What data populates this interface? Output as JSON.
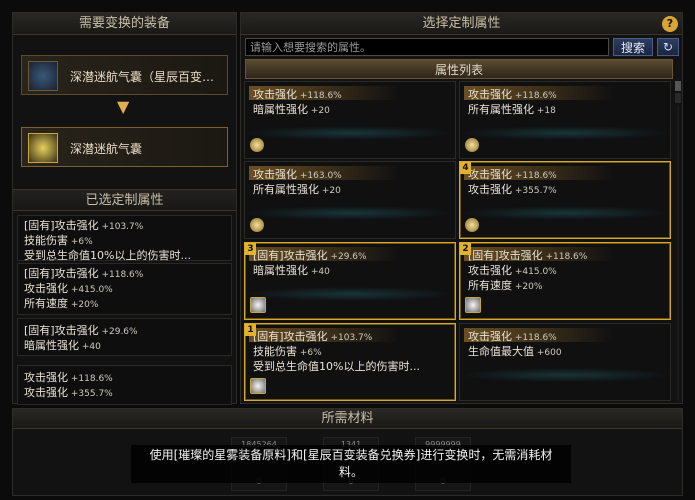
{
  "left": {
    "title": "需要变换的装备",
    "source_equip": "深潜迷航气囊（星辰百变…",
    "target_equip": "深潜迷航气囊",
    "selected_title": "已选定制属性",
    "selected": [
      {
        "lines": [
          {
            "t": "[固有]攻击强化",
            "v": "+103.7%"
          },
          {
            "t": "技能伤害",
            "v": "+6%"
          },
          {
            "t": "受到总生命值10%以上的伤害时...",
            "v": ""
          }
        ]
      },
      {
        "lines": [
          {
            "t": "[固有]攻击强化",
            "v": "+118.6%"
          },
          {
            "t": "攻击强化",
            "v": "+415.0%"
          },
          {
            "t": "所有速度",
            "v": "+20%"
          }
        ]
      },
      {
        "lines": [
          {
            "t": "[固有]攻击强化",
            "v": "+29.6%"
          },
          {
            "t": "暗属性强化",
            "v": "+40"
          }
        ]
      },
      {
        "lines": [
          {
            "t": "攻击强化",
            "v": "+118.6%"
          },
          {
            "t": "攻击强化",
            "v": "+355.7%"
          }
        ]
      }
    ]
  },
  "right": {
    "title": "选择定制属性",
    "help": "?",
    "search_placeholder": "请输入想要搜索的属性。",
    "search_button": "搜索",
    "refresh_icon": "↻",
    "list_title": "属性列表",
    "cards": [
      {
        "badge": "",
        "highlighted": false,
        "icon": "gem",
        "lines": [
          {
            "t": "攻击强化",
            "v": "+118.6%"
          },
          {
            "t": "暗属性强化",
            "v": "+20"
          }
        ]
      },
      {
        "badge": "",
        "highlighted": false,
        "icon": "gem",
        "lines": [
          {
            "t": "攻击强化",
            "v": "+118.6%"
          },
          {
            "t": "所有属性强化",
            "v": "+18"
          }
        ]
      },
      {
        "badge": "",
        "highlighted": false,
        "icon": "gem",
        "lines": [
          {
            "t": "攻击强化",
            "v": "+163.0%"
          },
          {
            "t": "所有属性强化",
            "v": "+20"
          }
        ]
      },
      {
        "badge": "4",
        "highlighted": true,
        "icon": "gem",
        "lines": [
          {
            "t": "攻击强化",
            "v": "+118.6%"
          },
          {
            "t": "攻击强化",
            "v": "+355.7%"
          }
        ]
      },
      {
        "badge": "3",
        "highlighted": true,
        "icon": "box",
        "lines": [
          {
            "t": "[固有]攻击强化",
            "v": "+29.6%"
          },
          {
            "t": "暗属性强化",
            "v": "+40"
          }
        ]
      },
      {
        "badge": "2",
        "highlighted": true,
        "icon": "box",
        "lines": [
          {
            "t": "[固有]攻击强化",
            "v": "+118.6%"
          },
          {
            "t": "攻击强化",
            "v": "+415.0%"
          },
          {
            "t": "所有速度",
            "v": "+20%"
          }
        ]
      },
      {
        "badge": "1",
        "highlighted": true,
        "icon": "box",
        "lines": [
          {
            "t": "[固有]攻击强化",
            "v": "+103.7%"
          },
          {
            "t": "技能伤害",
            "v": "+6%"
          },
          {
            "t": "受到总生命值10%以上的伤害时...",
            "v": ""
          }
        ]
      },
      {
        "badge": "",
        "highlighted": false,
        "icon": "none",
        "lines": [
          {
            "t": "攻击强化",
            "v": "+118.6%"
          },
          {
            "t": "生命值最大值",
            "v": "+600"
          }
        ]
      }
    ]
  },
  "bottom": {
    "title": "所需材料",
    "materials": [
      {
        "count": "1845264",
        "have": "0"
      },
      {
        "count": "1341",
        "have": "0"
      },
      {
        "count": "9999999",
        "have": "0"
      }
    ],
    "tooltip": "使用[璀璨的星雾装备原料]和[星辰百变装备兑换券]进行变换时，无需消耗材料。"
  }
}
